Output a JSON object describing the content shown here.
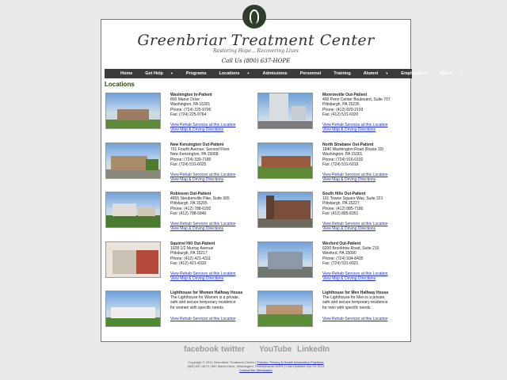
{
  "header": {
    "brand": "Greenbriar Treatment Center",
    "tagline": "Restoring Hope... Recovering Lives",
    "phone": "Call Us (800) 637-HOPE"
  },
  "nav": [
    {
      "label": "Home",
      "caret": false
    },
    {
      "label": "Get Help",
      "caret": true
    },
    {
      "label": "Programs",
      "caret": false
    },
    {
      "label": "Locations",
      "caret": true
    },
    {
      "label": "Admissions",
      "caret": false
    },
    {
      "label": "Personnel",
      "caret": false
    },
    {
      "label": "Training",
      "caret": false
    },
    {
      "label": "Alumni",
      "caret": true
    },
    {
      "label": "Employment",
      "caret": false
    },
    {
      "label": "About",
      "caret": true
    }
  ],
  "caret_glyph": "▼",
  "page_title": "Locations",
  "link_rehab": "View Rehab Services at this Location",
  "link_map": "View Map & Driving Directions",
  "locations": [
    {
      "name": "Washington In-Patient",
      "lines": [
        "800 Manor Drive",
        "Washington, PA 15301",
        "Phone: (724) 225-9700",
        "Fax: (724) 225-9764"
      ],
      "map": true
    },
    {
      "name": "Monroeville Out-Patient",
      "lines": [
        "400 Penn Center Boulevard, Suite 707",
        "Pittsburgh, PA 15235",
        "Phone: (412) 829-2103",
        "Fax: (412) 531-6920"
      ],
      "map": true
    },
    {
      "name": "New Kensington Out-Patient",
      "lines": [
        "701 Fourth Avenue, Second Floor",
        "New Kensington, PA 15068",
        "Phone: (724) 339-7180",
        "Fax: (724) 531-6025"
      ],
      "map": true
    },
    {
      "name": "North Strabane Out-Patient",
      "lines": [
        "1840 Washington Road (Route 19)",
        "Washington, PA 15301",
        "Phone: (724) 916-0192",
        "Fax: (724) 531-6019"
      ],
      "map": true
    },
    {
      "name": "Robinson Out-Patient",
      "lines": [
        "4955 Steubenville Pike, Suite 365",
        "Pittsburgh, PA 15205",
        "Phone: (412) 788-6292",
        "Fax: (412) 788-5846"
      ],
      "map": true
    },
    {
      "name": "South Hills Out-Patient",
      "lines": [
        "101 Towne Square Way, Suite 221",
        "Pittsburgh, PA 15227",
        "Phone: (412) 885-7180",
        "Fax: (412) 885-8351"
      ],
      "map": true
    },
    {
      "name": "Squirrel Hill Out-Patient",
      "lines": [
        "1928 1/2 Murray Avenue",
        "Pittsburgh, PA 15217",
        "Phone: (412) 421-4311",
        "Fax: (412) 421-4332"
      ],
      "map": true
    },
    {
      "name": "Wexford Out-Patient",
      "lines": [
        "6200 Brooktree Road, Suite 210",
        "Wexford, PA 15090",
        "Phone: (724) 934-8435",
        "Fax: (724) 531-6021"
      ],
      "map": true
    },
    {
      "name": "Lighthouse for Women Halfway House",
      "lines": [
        "The Lighthouse for Women is a private,",
        "safe and secure temporary residence",
        "for women with specific needs."
      ],
      "map": false
    },
    {
      "name": "Lighthouse for Men Halfway House",
      "lines": [
        "The Lighthouse for Men is a private,",
        "safe and secure temporary residence",
        "for men with specific needs."
      ],
      "map": false
    }
  ],
  "social": [
    "facebook",
    "twitter",
    "YouTube",
    "LinkedIn"
  ],
  "footer": {
    "line1_prefix": "Copyright © 2010 Greenbriar Treatment Center |",
    "policies_link": "Policies, Privacy & Health Information Practices",
    "line2": "(800) 637-4673 | 800 Manor Drive, Washington, Pennsylvania 15301 | Last Updated: Apr 15, 2011",
    "contact_link": "Contact the Webmaster"
  }
}
